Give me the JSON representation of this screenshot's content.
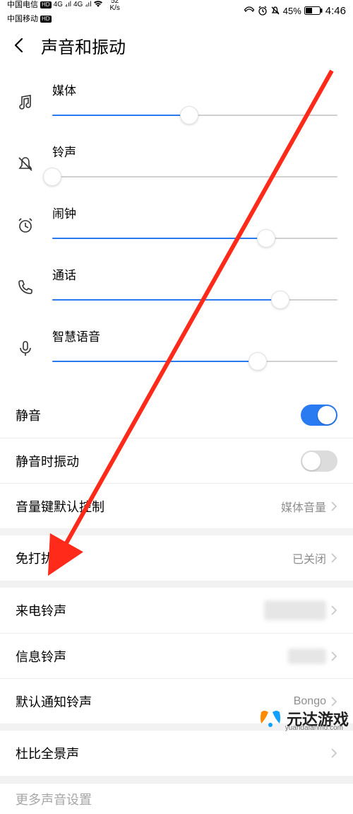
{
  "status": {
    "carrier1": "中国电信",
    "carrier2": "中国移动",
    "hd": "HD",
    "net_speed_top": "52",
    "net_speed_bot": "K/s",
    "sig4g": "4G",
    "battery_pct": "45%",
    "time": "4:46"
  },
  "header": {
    "title": "声音和振动"
  },
  "sliders": {
    "media": {
      "label": "媒体",
      "value": 48
    },
    "ring": {
      "label": "铃声",
      "value": 0
    },
    "alarm": {
      "label": "闹钟",
      "value": 75
    },
    "call": {
      "label": "通话",
      "value": 80
    },
    "voice": {
      "label": "智慧语音",
      "value": 72
    }
  },
  "toggles": {
    "silent": {
      "label": "静音",
      "on": true
    },
    "vibrate_silent": {
      "label": "静音时振动",
      "on": false
    }
  },
  "rows": {
    "volume_key": {
      "label": "音量键默认控制",
      "value": "媒体音量"
    },
    "dnd": {
      "label": "免打扰",
      "value": "已关闭"
    },
    "ringtone_call": {
      "label": "来电铃声",
      "value": "——"
    },
    "ringtone_msg": {
      "label": "信息铃声",
      "value": "——"
    },
    "ringtone_def": {
      "label": "默认通知铃声",
      "value": "Bongo"
    },
    "dolby": {
      "label": "杜比全景声",
      "value": ""
    },
    "more": {
      "label": "更多声音设置"
    }
  },
  "watermark": {
    "brand": "元达游戏",
    "url": "yuandafanmd.com"
  }
}
